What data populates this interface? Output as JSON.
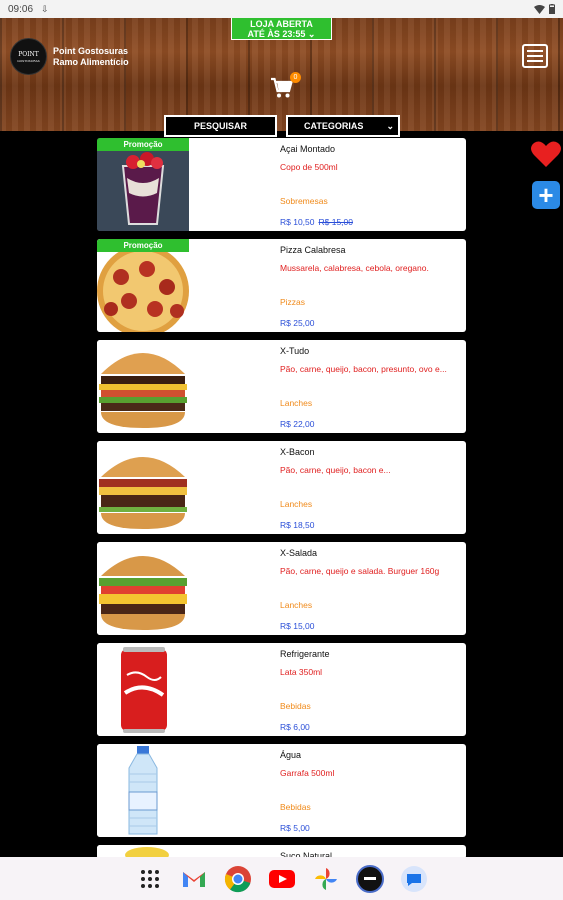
{
  "statusbar": {
    "time": "09:06",
    "icons": [
      "download-icon",
      "wifi-icon",
      "battery-icon"
    ]
  },
  "header": {
    "store_status_line1": "LOJA ABERTA",
    "store_status_line2": "ATÉ ÀS 23:55",
    "logo_text": "POINT",
    "logo_subtext": "GOSTOSURAS",
    "brand_line1": "Point Gostosuras",
    "brand_line2": "Ramo Alimentício",
    "cart_count": "0",
    "search_label": "PESQUISAR",
    "categories_label": "CATEGORIAS"
  },
  "promo_label": "Promoção",
  "products": [
    {
      "name": "Açai Montado",
      "desc": "Copo de 500ml",
      "category": "Sobremesas",
      "price": "R$ 10,50",
      "old_price": "R$ 15,00",
      "promo": true
    },
    {
      "name": "Pizza Calabresa",
      "desc": "Mussarela, calabresa, cebola, oregano.",
      "category": "Pizzas",
      "price": "R$ 25,00",
      "promo": true
    },
    {
      "name": "X-Tudo",
      "desc": "Pão, carne, queijo, bacon, presunto, ovo e...",
      "category": "Lanches",
      "price": "R$ 22,00"
    },
    {
      "name": "X-Bacon",
      "desc": "Pão, carne, queijo, bacon e...",
      "category": "Lanches",
      "price": "R$ 18,50"
    },
    {
      "name": "X-Salada",
      "desc": "Pão, carne, queijo e salada. Burguer 160g",
      "category": "Lanches",
      "price": "R$ 15,00"
    },
    {
      "name": "Refrigerante",
      "desc": "Lata 350ml",
      "category": "Bebidas",
      "price": "R$ 6,00"
    },
    {
      "name": "Água",
      "desc": "Garrafa 500ml",
      "category": "Bebidas",
      "price": "R$ 5,00"
    },
    {
      "name": "Suco Natural"
    }
  ],
  "colors": {
    "promo": "#2fbf2f",
    "desc": "#e02020",
    "category": "#f08a1a",
    "price": "#2b4fd8",
    "plus": "#2b8ae6",
    "heart": "#e82020"
  },
  "dock": [
    "apps-icon",
    "gmail-icon",
    "chrome-icon",
    "youtube-icon",
    "photos-icon",
    "point-app-icon",
    "messages-icon"
  ]
}
